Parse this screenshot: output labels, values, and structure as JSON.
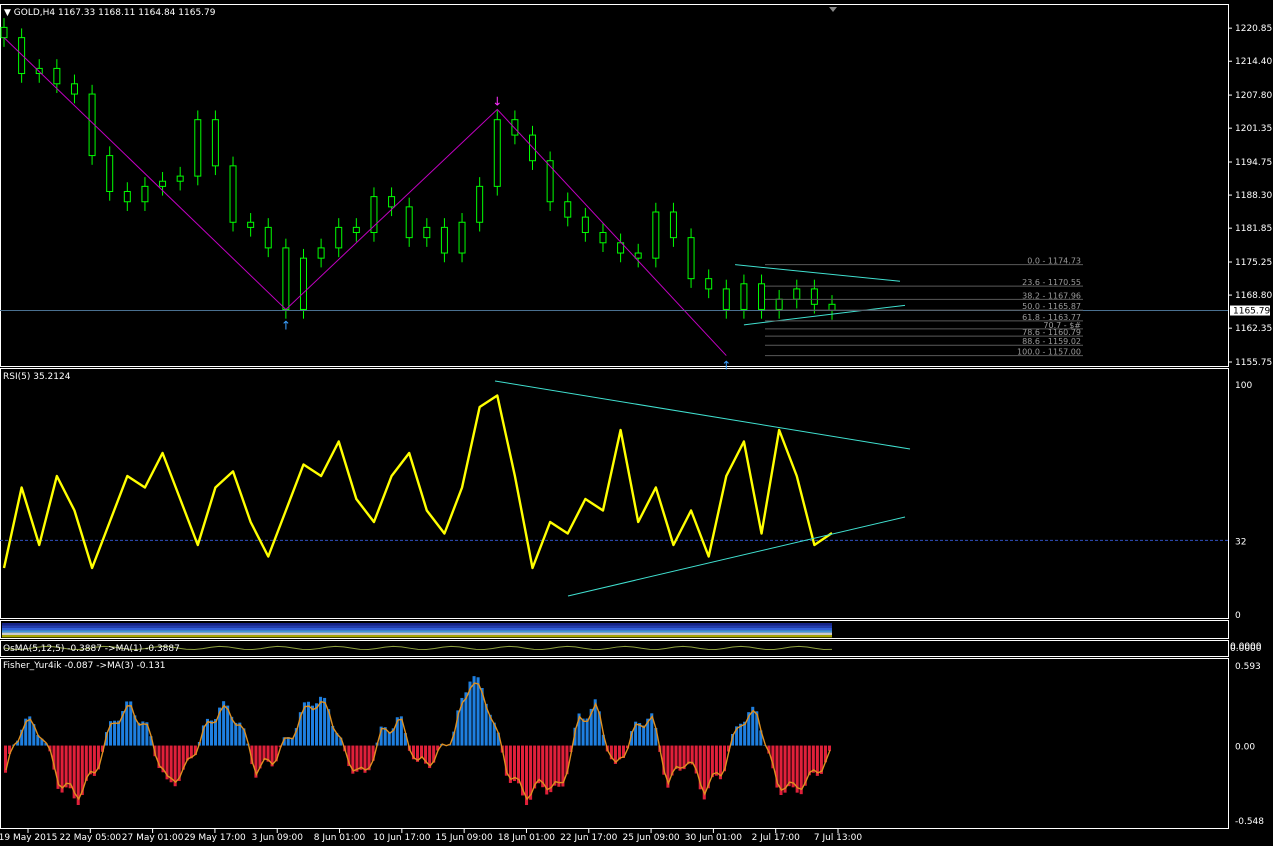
{
  "main": {
    "title": "GOLD,H4",
    "ohlc": "1167.33 1168.11 1164.84 1165.79",
    "price_ticks": [
      "1220.85",
      "1214.40",
      "1207.80",
      "1201.35",
      "1194.75",
      "1188.30",
      "1181.85",
      "1175.25",
      "1168.80",
      "1162.35",
      "1155.75"
    ],
    "current_price": "1165.79"
  },
  "fib": [
    {
      "label": "0.0 - 1174.73",
      "price": 1174.73
    },
    {
      "label": "23.6 - 1170.55",
      "price": 1170.55
    },
    {
      "label": "38.2 - 1167.96",
      "price": 1167.96
    },
    {
      "label": "50.0 - 1165.87",
      "price": 1165.87
    },
    {
      "label": "61.8 - 1163.77",
      "price": 1163.77
    },
    {
      "label": "70.7 - $#",
      "price": 1162.2
    },
    {
      "label": "78.6 - 1160.79",
      "price": 1160.79
    },
    {
      "label": "88.6 - 1159.02",
      "price": 1159.02
    },
    {
      "label": "100.0 - 1157.00",
      "price": 1157.0
    }
  ],
  "rsi": {
    "title": "RSI(5) 35.2124",
    "ticks": [
      "100",
      "32",
      "0"
    ]
  },
  "osma": {
    "title": "OsMA(5,12,5) -0.3887  ->MA(1) -0.3887",
    "ticks": [
      "0.0000",
      "0.0000"
    ]
  },
  "fisher": {
    "title": "Fisher_Yur4ik -0.087  ->MA(3) -0.131",
    "ticks": [
      "0.593",
      "0.00",
      "-0.548"
    ]
  },
  "time_axis": [
    "19 May 2015",
    "22 May 05:00",
    "27 May 01:00",
    "29 May 17:00",
    "3 Jun 09:00",
    "8 Jun 01:00",
    "10 Jun 17:00",
    "15 Jun 09:00",
    "18 Jun 01:00",
    "22 Jun 17:00",
    "25 Jun 09:00",
    "30 Jun 01:00",
    "2 Jul 17:00",
    "7 Jul 13:00"
  ],
  "colors": {
    "candles": "#00ff00",
    "rsi_line": "#ffff00",
    "trendline": "#40e0d0",
    "zigzag": "#c000c0",
    "fisher_pos": "#1e7fe0",
    "fisher_neg": "#e0203a",
    "fisher_ma": "#e09020",
    "grid_border": "#ffffff",
    "current_price_line": "#4a7090"
  },
  "chart_data": [
    {
      "type": "line",
      "title": "GOLD,H4",
      "series": [
        {
          "name": "GOLD,H4",
          "values": [
            1219,
            1212,
            1213,
            1210,
            1208,
            1196,
            1189,
            1187,
            1190,
            1191,
            1192,
            1203,
            1194,
            1183,
            1182,
            1178,
            1166,
            1176,
            1178,
            1182,
            1181,
            1188,
            1186,
            1180,
            1182,
            1177,
            1183,
            1190,
            1203,
            1200,
            1195,
            1187,
            1184,
            1181,
            1179,
            1177,
            1176,
            1185,
            1180,
            1172,
            1170,
            1166,
            1171,
            1166,
            1168,
            1170,
            1167,
            1165.79
          ]
        }
      ],
      "ylim": [
        1155.75,
        1224
      ]
    },
    {
      "type": "line",
      "title": "RSI(5) 35.2124",
      "series": [
        {
          "name": "RSI(5)",
          "values": [
            20,
            55,
            30,
            60,
            45,
            20,
            40,
            60,
            55,
            70,
            50,
            30,
            55,
            62,
            40,
            25,
            45,
            65,
            60,
            75,
            50,
            40,
            60,
            70,
            45,
            35,
            55,
            90,
            95,
            60,
            20,
            40,
            35,
            50,
            45,
            80,
            40,
            55,
            30,
            45,
            25,
            60,
            75,
            35,
            80,
            60,
            30,
            35.2
          ]
        }
      ],
      "ylim": [
        0,
        100
      ]
    },
    {
      "type": "bar",
      "title": "Fisher_Yur4ik -0.087  ->MA(3) -0.131",
      "series": [
        {
          "name": "Fisher_Yur4ik",
          "values": [
            -0.2,
            0.2,
            0.1,
            -0.3,
            -0.4,
            -0.2,
            0.2,
            0.3,
            0.1,
            -0.3,
            -0.2,
            0.1,
            0.3,
            0.2,
            -0.2,
            -0.1,
            0.1,
            0.35,
            0.3,
            -0.1,
            -0.25,
            0.1,
            0.2,
            -0.15,
            -0.1,
            0.1,
            0.55,
            0.3,
            -0.2,
            -0.4,
            -0.3,
            -0.35,
            0.2,
            0.3,
            -0.2,
            0.1,
            0.25,
            -0.3,
            -0.1,
            -0.35,
            -0.2,
            0.2,
            0.25,
            -0.3,
            -0.35,
            -0.25,
            -0.087
          ]
        }
      ],
      "ylim": [
        -0.548,
        0.593
      ]
    }
  ]
}
